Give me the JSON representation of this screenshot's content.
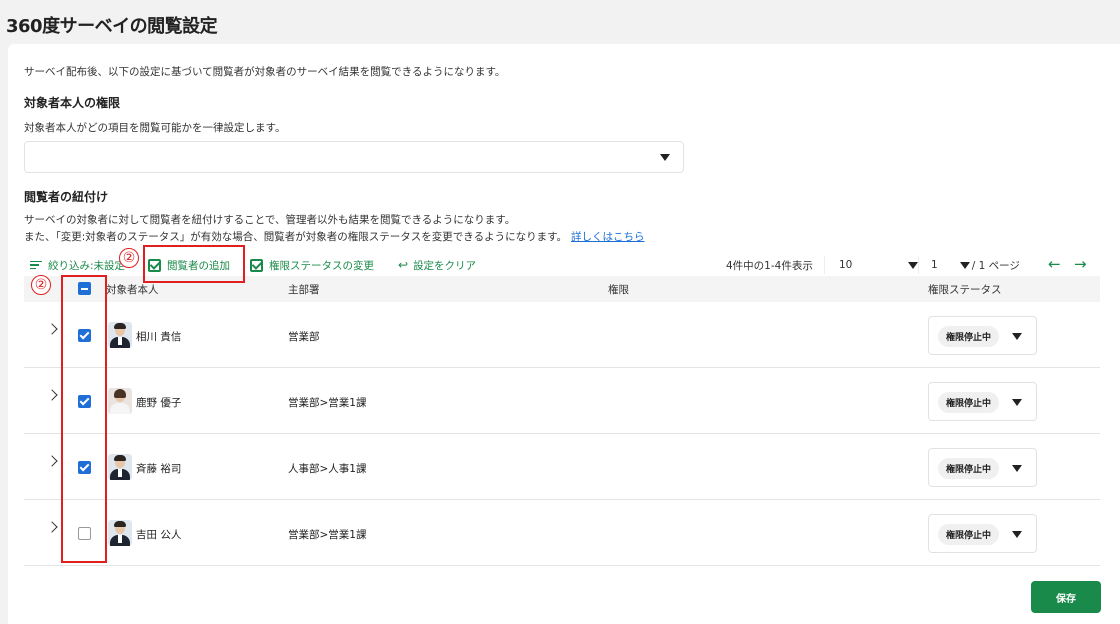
{
  "page": {
    "title": "360度サーベイの閲覧設定",
    "intro": "サーベイ配布後、以下の設定に基づいて閲覧者が対象者のサーベイ結果を閲覧できるようになります。"
  },
  "self_permission": {
    "heading": "対象者本人の権限",
    "description": "対象者本人がどの項目を閲覧可能かを一律設定します。",
    "select_value": ""
  },
  "viewer_link": {
    "heading": "閲覧者の紐付け",
    "description1": "サーベイの対象者に対して閲覧者を紐付けすることで、管理者以外も結果を閲覧できるようになります。",
    "description2": "また、「変更:対象者のステータス」が有効な場合、閲覧者が対象者の権限ステータスを変更できるようになります。",
    "link": "詳しくはこちら"
  },
  "toolbar": {
    "filter": "絞り込み:未設定",
    "add_viewer": "閲覧者の追加",
    "change_status": "権限ステータスの変更",
    "clear": "設定をクリア"
  },
  "pagination": {
    "count": "4件中の1-4件表示",
    "page_size": "10",
    "page": "1",
    "page_total": "/ 1 ページ",
    "prev": "←",
    "next": "→"
  },
  "table": {
    "headers": [
      "対象者本人",
      "主部署",
      "権限",
      "権限ステータス"
    ],
    "rows": [
      {
        "name": "相川 貴信",
        "dept": "営業部",
        "status": "権限停止中",
        "checked": true
      },
      {
        "name": "鹿野 優子",
        "dept": "営業部>営業1課",
        "status": "権限停止中",
        "checked": true
      },
      {
        "name": "斉藤 裕司",
        "dept": "人事部>人事1課",
        "status": "権限停止中",
        "checked": true
      },
      {
        "name": "吉田 公人",
        "dept": "営業部>営業1課",
        "status": "権限停止中",
        "checked": false
      }
    ]
  },
  "save_button": "保存",
  "annotations": {
    "marker": "②",
    "color": "#e02020"
  },
  "colors": {
    "accent_green": "#1a8a4a",
    "checkbox_blue": "#1f6fd6",
    "link_blue": "#1a6fd6"
  }
}
